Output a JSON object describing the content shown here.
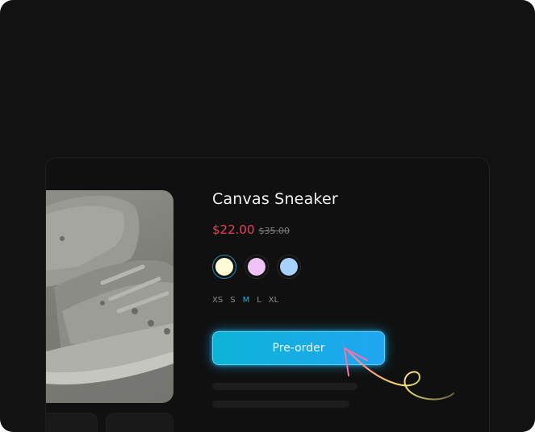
{
  "product": {
    "title": "Canvas Sneaker",
    "price": "$22.00",
    "original_price": "$35.00",
    "colors": [
      {
        "name": "cream",
        "hex": "#fffbd4",
        "selected": true
      },
      {
        "name": "pink",
        "hex": "#f0c2f7",
        "selected": false
      },
      {
        "name": "light-blue",
        "hex": "#a7d1ff",
        "selected": false
      }
    ],
    "sizes": [
      {
        "label": "XS",
        "active": false
      },
      {
        "label": "S",
        "active": false
      },
      {
        "label": "M",
        "active": true
      },
      {
        "label": "L",
        "active": false
      },
      {
        "label": "XL",
        "active": false
      }
    ],
    "cta_label": "Pre-order"
  },
  "theme": {
    "background": "#121212",
    "price_color": "#ee3f5a",
    "accent": "#20a6f2"
  }
}
